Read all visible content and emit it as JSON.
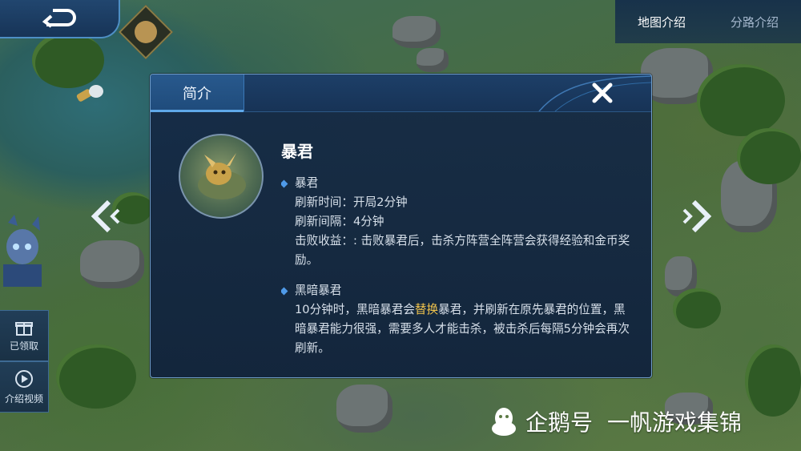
{
  "top_tabs": {
    "map_intro": "地图介绍",
    "lane_intro": "分路介绍"
  },
  "left_buttons": {
    "claimed": "已领取",
    "intro_video": "介绍视频"
  },
  "dialog": {
    "tab_label": "简介",
    "monster_name": "暴君",
    "sections": [
      {
        "title": "暴君",
        "lines": [
          "刷新时间：开局2分钟",
          "刷新间隔：4分钟",
          "击败收益：: 击败暴君后，击杀方阵营全阵营会获得经验和金币奖励。"
        ]
      },
      {
        "title": "黑暗暴君",
        "text_before": "10分钟时，黑暗暴君会",
        "highlight": "替换",
        "text_after": "暴君，并刷新在原先暴君的位置，黑暗暴君能力很强，需要多人才能击杀，被击杀后每隔5分钟会再次刷新。"
      }
    ]
  },
  "watermark": {
    "brand": "企鹅号",
    "author": "一帆游戏集锦"
  },
  "colors": {
    "accent": "#5fa9ea",
    "highlight": "#f1c44d",
    "panel": "#172f52"
  }
}
